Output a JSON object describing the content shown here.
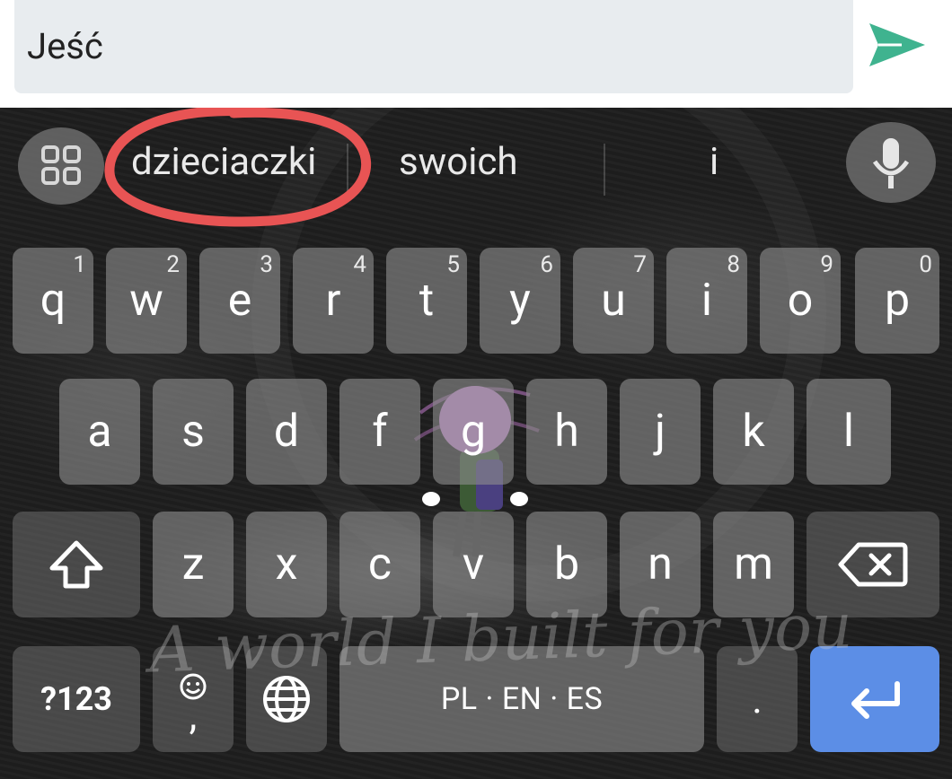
{
  "input": {
    "text": "Jeść",
    "send_icon": "send-icon"
  },
  "suggestions": {
    "items": [
      "dzieciaczki",
      "swoich",
      "i"
    ],
    "menu_icon": "apps-grid-icon",
    "mic_icon": "microphone-icon",
    "highlight_color": "#e85454"
  },
  "keyboard": {
    "row1": [
      {
        "label": "q",
        "hint": "1"
      },
      {
        "label": "w",
        "hint": "2"
      },
      {
        "label": "e",
        "hint": "3"
      },
      {
        "label": "r",
        "hint": "4"
      },
      {
        "label": "t",
        "hint": "5"
      },
      {
        "label": "y",
        "hint": "6"
      },
      {
        "label": "u",
        "hint": "7"
      },
      {
        "label": "i",
        "hint": "8"
      },
      {
        "label": "o",
        "hint": "9"
      },
      {
        "label": "p",
        "hint": "0"
      }
    ],
    "row2": [
      "a",
      "s",
      "d",
      "f",
      "g",
      "h",
      "j",
      "k",
      "l"
    ],
    "row3": [
      "z",
      "x",
      "c",
      "v",
      "b",
      "n",
      "m"
    ],
    "shift_icon": "shift-arrow-icon",
    "backspace_icon": "backspace-icon",
    "symbols_label": "?123",
    "comma_label": ",",
    "emoji_icon": "emoji-icon",
    "globe_icon": "globe-icon",
    "space_label": "PL · EN · ES",
    "period_label": ".",
    "enter_icon": "enter-arrow-icon",
    "accent_color": "#5c8ee6"
  },
  "wallpaper": {
    "caption": "A world I built for you"
  }
}
